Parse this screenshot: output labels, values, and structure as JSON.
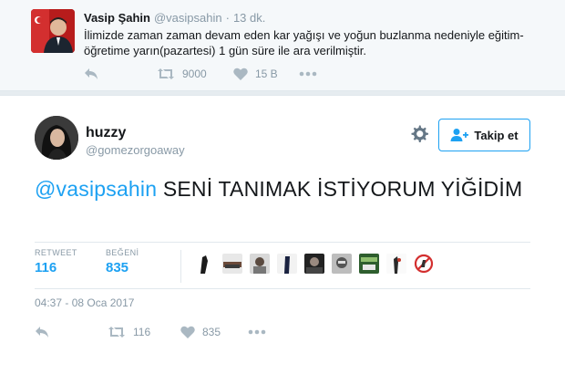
{
  "quoted_tweet": {
    "name": "Vasip Şahin",
    "handle": "@vasipsahin",
    "separator": "·",
    "time": "13 dk.",
    "text": "İlimizde zaman zaman devam eden kar yağışı ve yoğun buzlanma nedeniyle eğitim-öğretime yarın(pazartesi) 1 gün süre ile ara verilmiştir.",
    "retweets": "9000",
    "likes": "15 B",
    "icons": [
      "reply-icon",
      "retweet-icon",
      "heart-icon",
      "more-icon"
    ]
  },
  "main_tweet": {
    "name": "huzzy",
    "handle": "@gomezorgoaway",
    "follow_label": "Takip et",
    "mention": "@vasipsahin",
    "text": " SENİ TANIMAK İSTİYORUM YİĞİDİM",
    "stats": {
      "retweet_label": "RETWEET",
      "retweet_count": "116",
      "likes_label": "BEĞENİ",
      "likes_count": "835"
    },
    "liker_count": 9,
    "date": "04:37 - 08 Oca 2017",
    "action_retweets": "116",
    "action_likes": "835",
    "icons": [
      "settings-gear-icon",
      "follow-person-icon",
      "reply-icon",
      "retweet-icon",
      "heart-icon",
      "more-icon"
    ]
  },
  "colors": {
    "accent": "#1da1f2",
    "muted": "#8899a6",
    "text": "#14171a",
    "background": "#e6ecf0"
  }
}
